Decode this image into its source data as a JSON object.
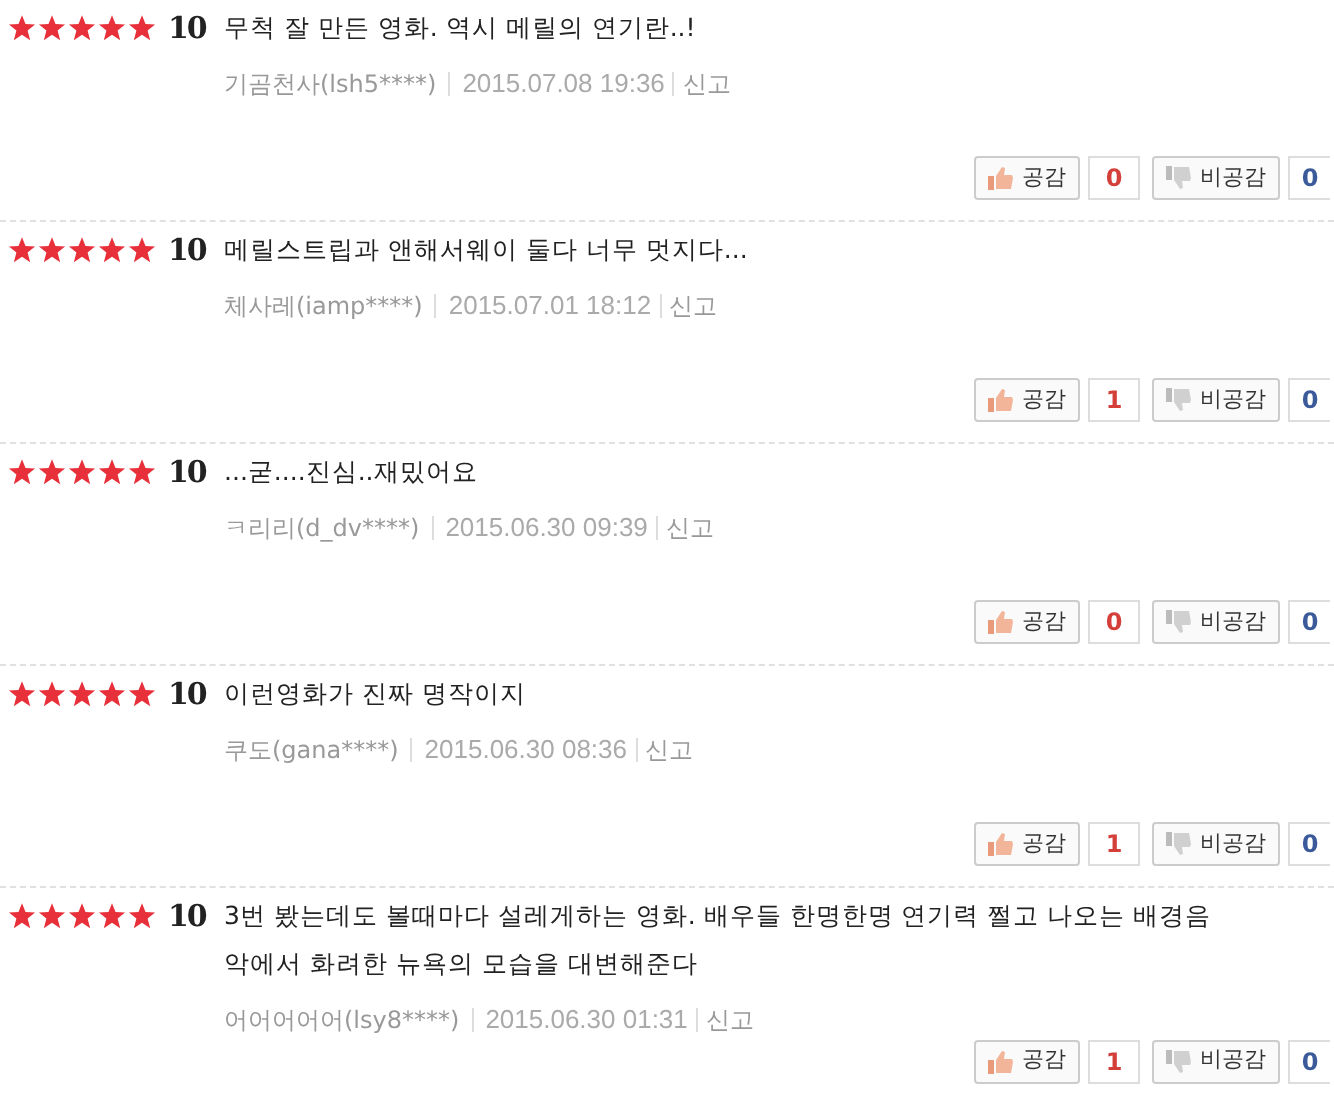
{
  "reviews": [
    {
      "stars": 5,
      "score": "10",
      "text": "무척 잘 만든 영화. 역시 메릴의 연기란..!",
      "author": "기곰천사(lsh5****)",
      "date": "2015.07.08 19:36",
      "report": "신고",
      "like_label": "공감",
      "likes": "0",
      "dislike_label": "비공감",
      "dislikes": "0"
    },
    {
      "stars": 5,
      "score": "10",
      "text": "메릴스트립과 앤해서웨이 둘다 너무 멋지다...",
      "author": "체사레(iamp****)",
      "date": "2015.07.01 18:12",
      "report": "신고",
      "like_label": "공감",
      "likes": "1",
      "dislike_label": "비공감",
      "dislikes": "0"
    },
    {
      "stars": 5,
      "score": "10",
      "text": "...굳....진심..재밌어요",
      "author": "ㅋ리리(d_dv****)",
      "date": "2015.06.30 09:39",
      "report": "신고",
      "like_label": "공감",
      "likes": "0",
      "dislike_label": "비공감",
      "dislikes": "0"
    },
    {
      "stars": 5,
      "score": "10",
      "text": "이런영화가 진짜 명작이지",
      "author": "쿠도(gana****)",
      "date": "2015.06.30 08:36",
      "report": "신고",
      "like_label": "공감",
      "likes": "1",
      "dislike_label": "비공감",
      "dislikes": "0"
    },
    {
      "stars": 5,
      "score": "10",
      "text": "3번 봤는데도 볼때마다 설레게하는 영화. 배우들 한명한명 연기력 쩔고 나오는 배경음악에서 화려한 뉴욕의 모습을 대변해준다",
      "author": "어어어어어(lsy8****)",
      "date": "2015.06.30 01:31",
      "report": "신고",
      "like_label": "공감",
      "likes": "1",
      "dislike_label": "비공감",
      "dislikes": "0"
    }
  ]
}
